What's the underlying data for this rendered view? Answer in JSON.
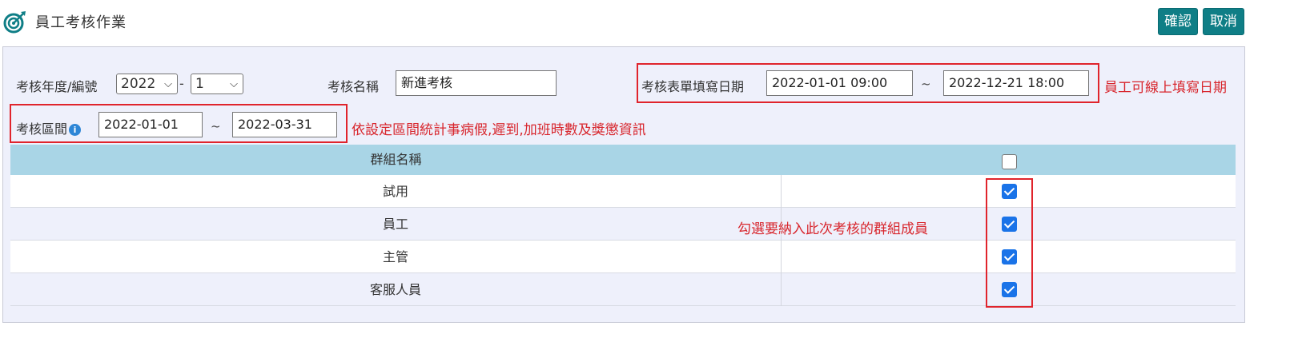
{
  "header": {
    "title": "員工考核作業",
    "logo_icon": "target-arrow-icon",
    "confirm_label": "確認",
    "cancel_label": "取消",
    "accent_color": "#0f7e86"
  },
  "form": {
    "year_label": "考核年度/編號",
    "year_value": "2022",
    "separator": "-",
    "number_value": "1",
    "name_label": "考核名稱",
    "name_value": "新進考核",
    "fill_date_label": "考核表單填寫日期",
    "fill_start": "2022-01-01 09:00",
    "fill_end": "2022-12-21 18:00",
    "tilde": "~",
    "period_label": "考核區間",
    "period_info_icon": "info-icon",
    "period_start": "2022-01-01",
    "period_end": "2022-03-31"
  },
  "annotations": {
    "fill_date_note": "員工可線上填寫日期",
    "period_note": "依設定區間統計事病假,遲到,加班時數及獎懲資訊",
    "groups_note": "勾選要納入此次考核的群組成員",
    "note_color": "#d8262d"
  },
  "table": {
    "header_name": "群組名稱",
    "header_checked": false,
    "rows": [
      {
        "name": "試用",
        "checked": true
      },
      {
        "name": "員工",
        "checked": true
      },
      {
        "name": "主管",
        "checked": true
      },
      {
        "name": "客服人員",
        "checked": true
      }
    ]
  }
}
